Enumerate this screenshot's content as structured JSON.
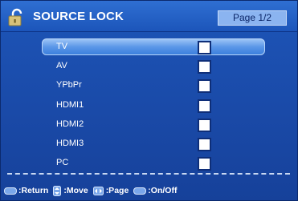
{
  "header": {
    "title": "SOURCE LOCK",
    "page": "Page 1/2",
    "icon": "lock-icon"
  },
  "sources": [
    {
      "label": "TV",
      "checked": false,
      "selected": true
    },
    {
      "label": "AV",
      "checked": false,
      "selected": false
    },
    {
      "label": "YPbPr",
      "checked": false,
      "selected": false
    },
    {
      "label": "HDMI1",
      "checked": false,
      "selected": false
    },
    {
      "label": "HDMI2",
      "checked": false,
      "selected": false
    },
    {
      "label": "HDMI3",
      "checked": false,
      "selected": false
    },
    {
      "label": "PC",
      "checked": false,
      "selected": false
    }
  ],
  "footer": {
    "return_label": ":Return",
    "move_label": ":Move",
    "page_label": ":Page",
    "onoff_label": ":On/Off",
    "return_key_icon": "menu-key-icon",
    "move_key_icon": "up-down-key-icon",
    "page_key_icon": "left-right-key-icon",
    "onoff_key_icon": "enter-key-icon"
  },
  "colors": {
    "background": "#1a4aa8",
    "highlight": "#5b97e8",
    "badge": "#8bb4f0"
  }
}
